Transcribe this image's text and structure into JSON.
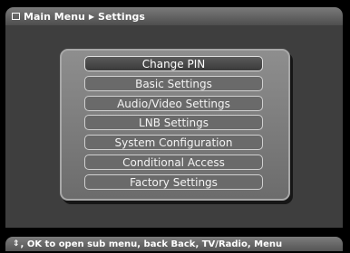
{
  "header": {
    "icon": "menu-box-icon",
    "breadcrumb_root": "Main Menu",
    "separator_icon": "right-triangle-icon",
    "breadcrumb_current": "Settings"
  },
  "menu": {
    "selected_index": 0,
    "items": [
      {
        "label": "Change PIN"
      },
      {
        "label": "Basic Settings"
      },
      {
        "label": "Audio/Video Settings"
      },
      {
        "label": "LNB Settings"
      },
      {
        "label": "System Configuration"
      },
      {
        "label": "Conditional Access"
      },
      {
        "label": "Factory Settings"
      }
    ]
  },
  "footer": {
    "icon": "up-down-arrows-icon",
    "hint": ", OK to open sub menu, back Back, TV/Radio, Menu"
  }
}
